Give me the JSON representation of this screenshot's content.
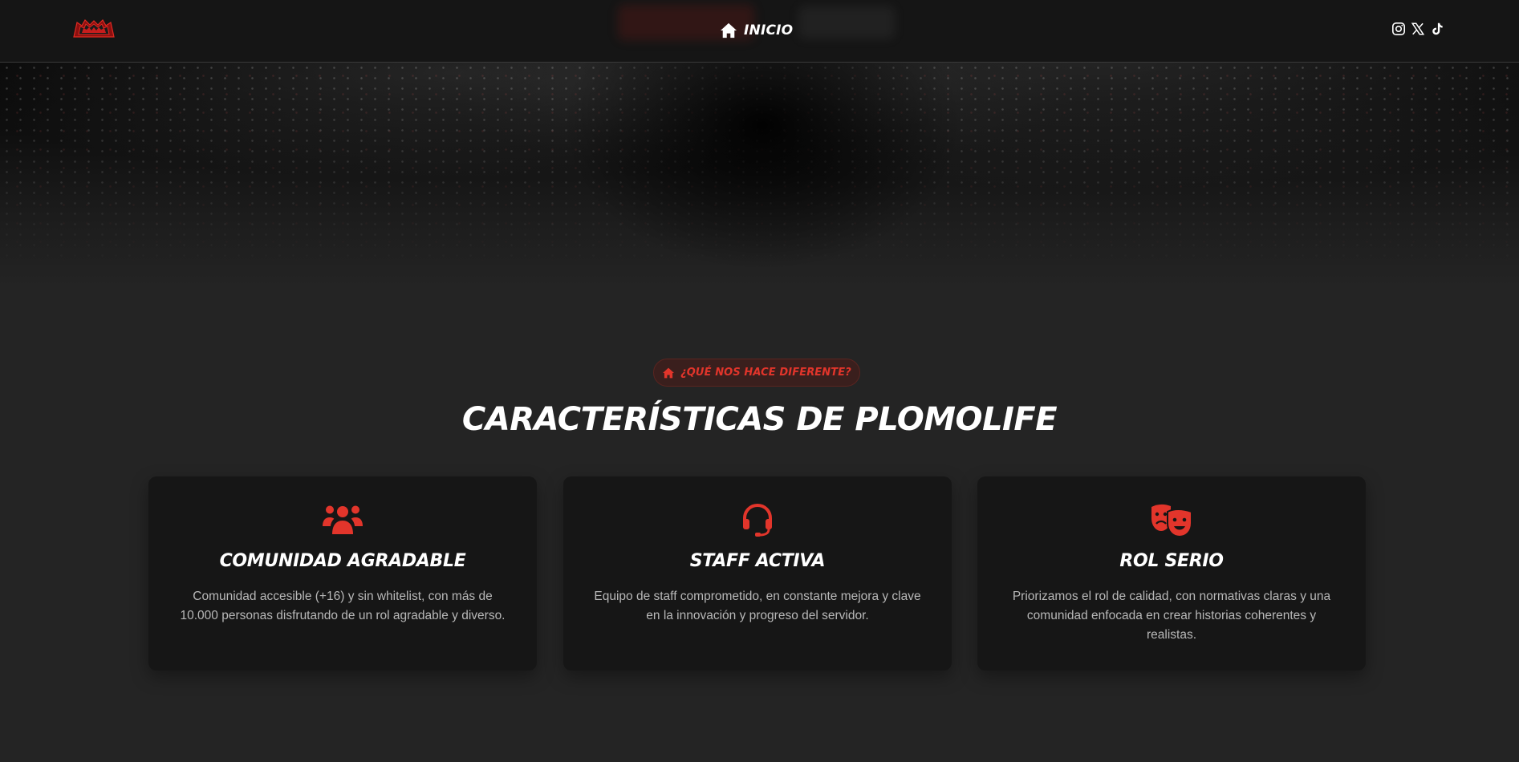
{
  "navbar": {
    "logo_alt": "PLOMOLIFE",
    "nav_link_label": "INICIO",
    "socials": [
      {
        "icon": "instagram-icon"
      },
      {
        "icon": "x-twitter-icon"
      },
      {
        "icon": "tiktok-icon"
      }
    ]
  },
  "section": {
    "badge_label": "¿QUÉ NOS HACE DIFERENTE?",
    "title": "CARACTERÍSTICAS DE PLOMOLIFE"
  },
  "cards": [
    {
      "icon": "users-icon",
      "title": "COMUNIDAD AGRADABLE",
      "text": "Comunidad accesible (+16) y sin whitelist, con más de 10.000 personas disfrutando de un rol agradable y diverso."
    },
    {
      "icon": "headset-icon",
      "title": "STAFF ACTIVA",
      "text": "Equipo de staff comprometido, en constante mejora y clave en la innovación y progreso del servidor."
    },
    {
      "icon": "theater-masks-icon",
      "title": "ROL SERIO",
      "text": "Priorizamos el rol de calidad, con normativas claras y una comunidad enfocada en crear historias coherentes y realistas."
    }
  ],
  "colors": {
    "accent": "#e2352b",
    "background": "#242424",
    "card": "#161616",
    "navbar": "#151515"
  }
}
